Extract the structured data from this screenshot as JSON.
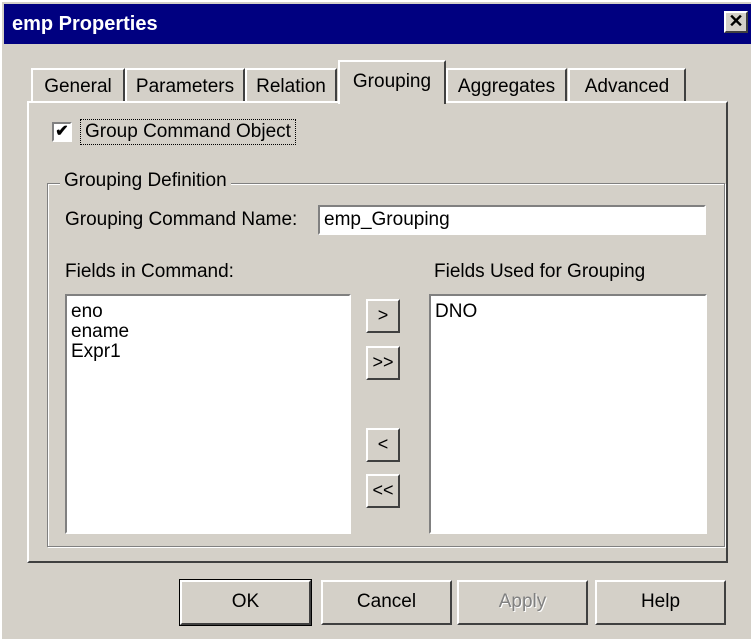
{
  "window": {
    "title": "emp Properties",
    "close_glyph": "✕"
  },
  "tabs": [
    {
      "label": "General"
    },
    {
      "label": "Parameters"
    },
    {
      "label": "Relation"
    },
    {
      "label": "Grouping",
      "active": true
    },
    {
      "label": "Aggregates"
    },
    {
      "label": "Advanced"
    }
  ],
  "grouping": {
    "group_command_object": {
      "label": "Group Command Object",
      "checked": true,
      "check_glyph": "✔"
    },
    "definition_legend": "Grouping Definition",
    "command_name_label": "Grouping Command Name:",
    "command_name_value": "emp_Grouping",
    "fields_in_command_label": "Fields in Command:",
    "fields_in_command": [
      "eno",
      "ename",
      "Expr1"
    ],
    "fields_for_grouping_label": "Fields Used for Grouping",
    "fields_for_grouping": [
      "DNO"
    ],
    "move_buttons": {
      "add": ">",
      "add_all": ">>",
      "remove": "<",
      "remove_all": "<<"
    }
  },
  "buttons": {
    "ok": "OK",
    "cancel": "Cancel",
    "apply": "Apply",
    "help": "Help"
  }
}
